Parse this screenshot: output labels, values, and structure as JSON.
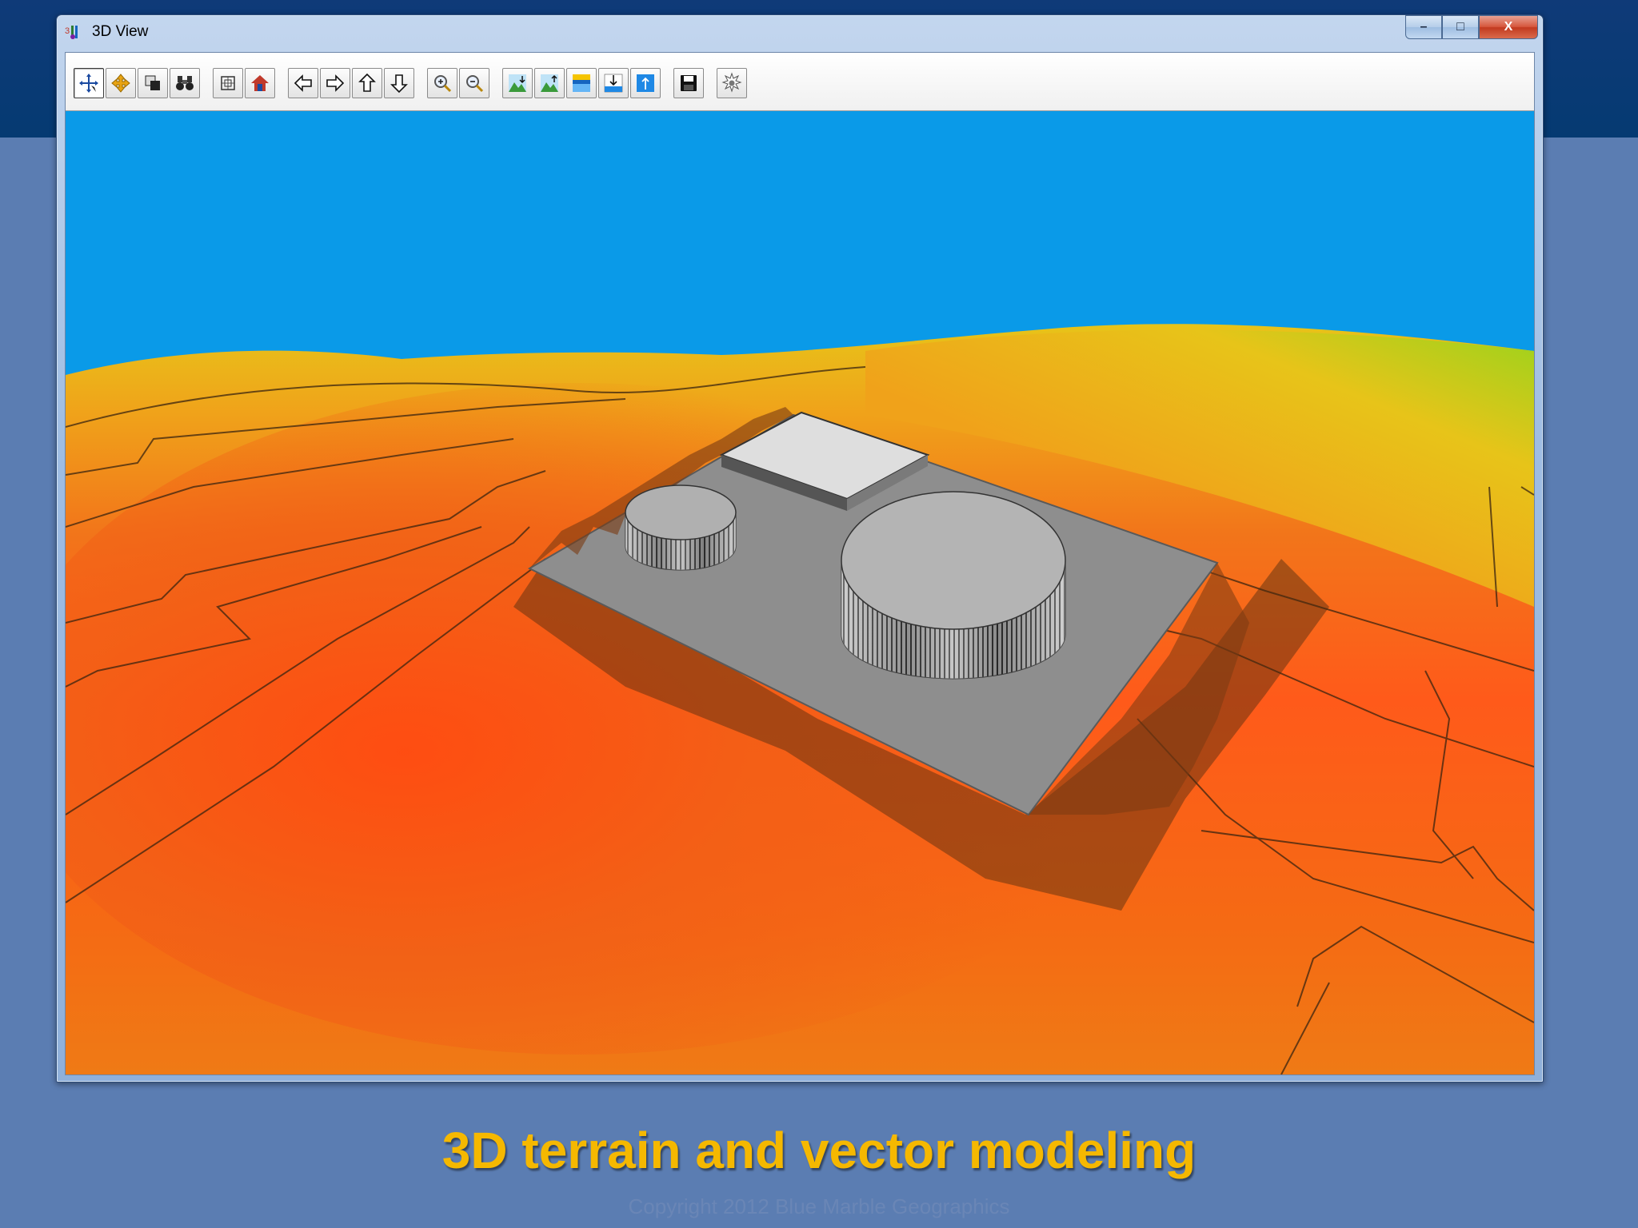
{
  "window": {
    "title": "3D View",
    "icon": "3d-view-app-icon",
    "controls": {
      "minimize": "–",
      "maximize": "□",
      "close": "X"
    }
  },
  "toolbar": {
    "buttons": [
      {
        "name": "select-tool",
        "icon": "crosshair-arrows-icon",
        "active": true
      },
      {
        "name": "pan-tool",
        "icon": "pan-arrows-icon"
      },
      {
        "name": "layers",
        "icon": "layers-icon"
      },
      {
        "name": "find",
        "icon": "binoculars-icon"
      },
      {
        "name": "fit-view",
        "icon": "bounding-box-icon"
      },
      {
        "name": "home-view",
        "icon": "house-icon"
      },
      {
        "name": "move-left",
        "icon": "arrow-left-icon"
      },
      {
        "name": "move-right",
        "icon": "arrow-right-icon"
      },
      {
        "name": "move-up",
        "icon": "arrow-up-icon"
      },
      {
        "name": "move-down",
        "icon": "arrow-down-icon"
      },
      {
        "name": "zoom-in",
        "icon": "zoom-in-icon"
      },
      {
        "name": "zoom-out",
        "icon": "zoom-out-icon"
      },
      {
        "name": "terrain-lower",
        "icon": "terrain-down-icon"
      },
      {
        "name": "terrain-raise",
        "icon": "terrain-up-icon"
      },
      {
        "name": "water-level",
        "icon": "water-level-icon"
      },
      {
        "name": "lower-water",
        "icon": "lower-water-icon"
      },
      {
        "name": "raise-water",
        "icon": "raise-water-icon"
      },
      {
        "name": "save-view",
        "icon": "floppy-disk-icon"
      },
      {
        "name": "settings",
        "icon": "settings-burst-icon"
      }
    ]
  },
  "scene": {
    "sky_color": "#0a9ae8",
    "terrain_colors": [
      "#ff5a1a",
      "#f2751a",
      "#f0a21a",
      "#e7c419",
      "#c6d21a",
      "#9bd31c"
    ],
    "pad_color": "#8e8e8e",
    "objects": [
      "terrain-surface",
      "contour-lines",
      "building-pad",
      "small-cylinder-tank",
      "rectangular-building",
      "large-cylinder-tank"
    ]
  },
  "caption": "3D terrain and vector modeling",
  "copyright": "Copyright 2012 Blue Marble Geographics",
  "colors": {
    "caption": "#f5b800",
    "background": "#5b7db2",
    "banner": "#0b3a76"
  }
}
